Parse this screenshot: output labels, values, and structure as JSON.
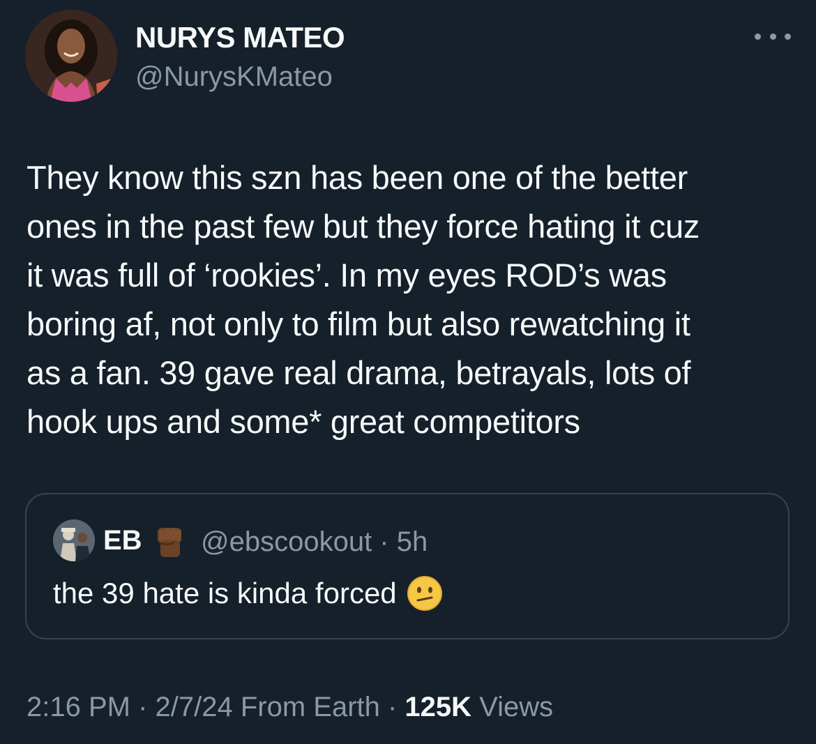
{
  "author": {
    "display_name": "NURYS MATEO",
    "handle": "@NurysKMateo",
    "avatar": "profile-photo"
  },
  "more_icon": "more-horizontal-icon",
  "tweet": {
    "text": "They know this szn has been one of the better\nones in the past few but they force hating it cuz\nit was full of ‘rookies’. In my eyes ROD’s was\nboring af, not only to film but also rewatching it\nas a fan. 39 gave real drama, betrayals, lots of\nhook ups and some* great competitors"
  },
  "quoted_tweet": {
    "display_name": "EB",
    "badge_emoji": "raised-fist-emoji",
    "handle_time": "@ebscookout · 5h",
    "text": "the 39 hate is kinda forced",
    "trailing_emoji": "confused-face-emoji"
  },
  "meta": {
    "time_date": "2:16 PM · 2/7/24 From Earth · ",
    "views_count": "125K",
    "views_label": " Views"
  },
  "colors": {
    "background": "#15202b",
    "primary_text": "#f7f9f9",
    "secondary_text": "#8b98a5",
    "border": "#38444d"
  }
}
